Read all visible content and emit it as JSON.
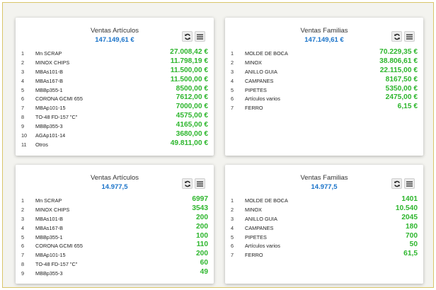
{
  "colors": {
    "accent_total": "#1a73c9",
    "value_green": "#2db62d"
  },
  "panels": [
    {
      "title": "Ventas Artículos",
      "total": "147.149,61 €",
      "sync_icon": "sync-icon",
      "menu_icon": "menu-icon",
      "rows": [
        {
          "idx": "1",
          "name": "Mn SCRAP",
          "value": "27.008,42 €"
        },
        {
          "idx": "2",
          "name": "MINOX CHIPS",
          "value": "11.798,19 €"
        },
        {
          "idx": "3",
          "name": "MBAs101-B",
          "value": "11.500,00 €"
        },
        {
          "idx": "4",
          "name": "MBAs167-B",
          "value": "11.500,00 €"
        },
        {
          "idx": "5",
          "name": "MBBp355-1",
          "value": "8500,00 €"
        },
        {
          "idx": "6",
          "name": "CORONA GCMI 655",
          "value": "7612,00 €"
        },
        {
          "idx": "7",
          "name": "MBAp101-15",
          "value": "7000,00 €"
        },
        {
          "idx": "8",
          "name": "TO-48 FD-157 \"C\"",
          "value": "4575,00 €"
        },
        {
          "idx": "9",
          "name": "MBBp355-3",
          "value": "4165,00 €"
        },
        {
          "idx": "10",
          "name": "AGAp101-14",
          "value": "3680,00 €"
        },
        {
          "idx": "11",
          "name": "Otros",
          "value": "49.811,00 €"
        }
      ]
    },
    {
      "title": "Ventas Familias",
      "total": "147.149,61 €",
      "sync_icon": "sync-icon",
      "menu_icon": "menu-icon",
      "rows": [
        {
          "idx": "1",
          "name": "MOLDE DE BOCA",
          "value": "70.229,35 €"
        },
        {
          "idx": "2",
          "name": "MINOX",
          "value": "38.806,61 €"
        },
        {
          "idx": "3",
          "name": "ANILLO GUIA",
          "value": "22.115,00 €"
        },
        {
          "idx": "4",
          "name": "CAMPANES",
          "value": "8167,50 €"
        },
        {
          "idx": "5",
          "name": "PIPETES",
          "value": "5350,00 €"
        },
        {
          "idx": "6",
          "name": "Artículos varios",
          "value": "2475,00 €"
        },
        {
          "idx": "7",
          "name": "FERRO",
          "value": "6,15 €"
        }
      ]
    },
    {
      "title": "Ventas Artículos",
      "total": "14.977,5",
      "sync_icon": "sync-icon",
      "menu_icon": "menu-icon",
      "rows": [
        {
          "idx": "1",
          "name": "Mn SCRAP",
          "value": "6997"
        },
        {
          "idx": "2",
          "name": "MINOX CHIPS",
          "value": "3543"
        },
        {
          "idx": "3",
          "name": "MBAs101-B",
          "value": "200"
        },
        {
          "idx": "4",
          "name": "MBAs167-B",
          "value": "200"
        },
        {
          "idx": "5",
          "name": "MBBp355-1",
          "value": "100"
        },
        {
          "idx": "6",
          "name": "CORONA GCMI 655",
          "value": "110"
        },
        {
          "idx": "7",
          "name": "MBAp101-15",
          "value": "200"
        },
        {
          "idx": "8",
          "name": "TO-48 FD-157 \"C\"",
          "value": "60"
        },
        {
          "idx": "9",
          "name": "MBBp355-3",
          "value": "49"
        }
      ]
    },
    {
      "title": "Ventas Familias",
      "total": "14.977,5",
      "sync_icon": "sync-icon",
      "menu_icon": "menu-icon",
      "rows": [
        {
          "idx": "1",
          "name": "MOLDE DE BOCA",
          "value": "1401"
        },
        {
          "idx": "2",
          "name": "MINOX",
          "value": "10.540"
        },
        {
          "idx": "3",
          "name": "ANILLO GUIA",
          "value": "2045"
        },
        {
          "idx": "4",
          "name": "CAMPANES",
          "value": "180"
        },
        {
          "idx": "5",
          "name": "PIPETES",
          "value": "700"
        },
        {
          "idx": "6",
          "name": "Artículos varios",
          "value": "50"
        },
        {
          "idx": "7",
          "name": "FERRO",
          "value": "61,5"
        }
      ]
    }
  ]
}
